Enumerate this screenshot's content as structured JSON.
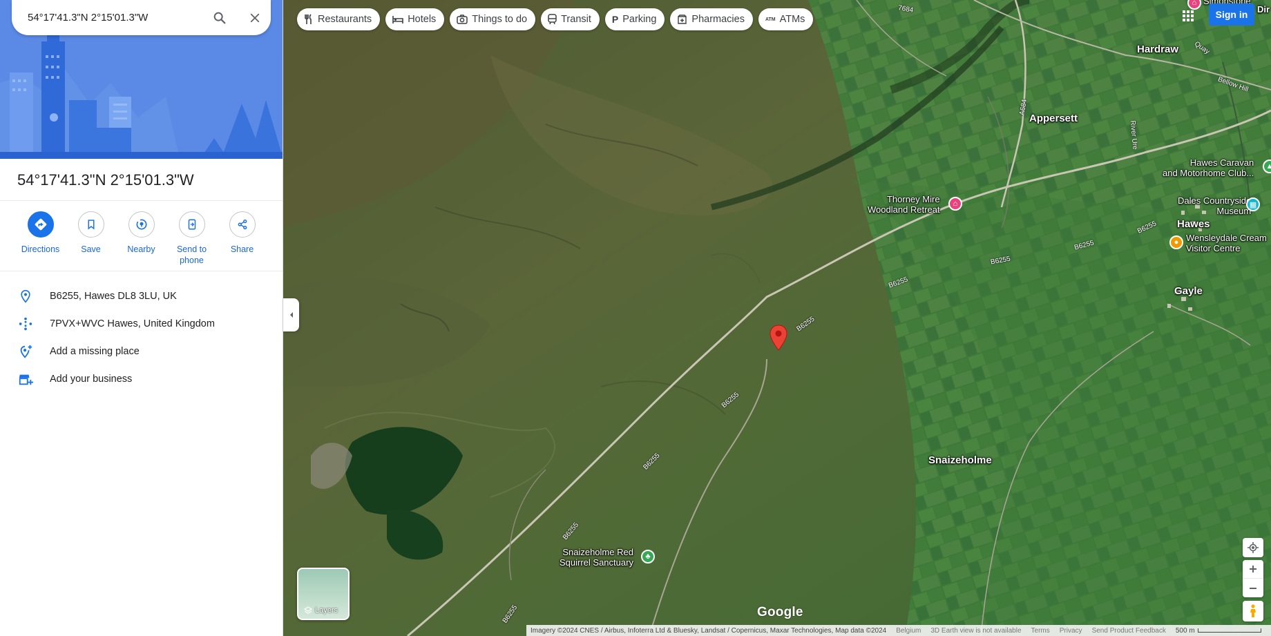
{
  "search": {
    "value": "54°17'41.3\"N 2°15'01.3\"W",
    "search_icon": "search-icon",
    "clear_icon": "close-icon"
  },
  "place": {
    "title": "54°17'41.3\"N 2°15'01.3\"W"
  },
  "actions": [
    {
      "label": "Directions",
      "icon": "directions-icon"
    },
    {
      "label": "Save",
      "icon": "bookmark-icon"
    },
    {
      "label": "Nearby",
      "icon": "nearby-icon"
    },
    {
      "label": "Send to phone",
      "icon": "phone-icon"
    },
    {
      "label": "Share",
      "icon": "share-icon"
    }
  ],
  "info": [
    {
      "text": "B6255, Hawes DL8 3LU, UK",
      "icon": "location-pin-icon"
    },
    {
      "text": "7PVX+WVC Hawes, United Kingdom",
      "icon": "plus-code-icon"
    },
    {
      "text": "Add a missing place",
      "icon": "add-location-icon"
    },
    {
      "text": "Add your business",
      "icon": "add-business-icon"
    }
  ],
  "chips": [
    {
      "label": "Restaurants",
      "icon": "restaurant-icon"
    },
    {
      "label": "Hotels",
      "icon": "hotel-icon"
    },
    {
      "label": "Things to do",
      "icon": "camera-icon"
    },
    {
      "label": "Transit",
      "icon": "transit-icon"
    },
    {
      "label": "Parking",
      "icon": "parking-icon"
    },
    {
      "label": "Pharmacies",
      "icon": "pharmacy-icon"
    },
    {
      "label": "ATMs",
      "icon": "atm-icon"
    }
  ],
  "header": {
    "signin": "Sign in"
  },
  "map_labels": {
    "hardraw": "Hardraw",
    "appersett": "Appersett",
    "thorney": "Thorney Mire\nWoodland Retreat",
    "hawes_caravan": "Hawes Caravan\nand Motorhome Club...",
    "dales": "Dales Countryside\nMuseum",
    "hawes": "Hawes",
    "wensleydale": "Wensleydale Cream\nVisitor Centre",
    "gayle": "Gayle",
    "snaizeholme": "Snaizeholme",
    "squirrel": "Snaizeholme Red\nSquirrel Sanctuary",
    "simonstone": "Simonstone",
    "dir": "Dir",
    "r7684": "7684",
    "r_a684": "A684",
    "river_ure": "River Ure",
    "quay": "Quay",
    "bellow_hill": "Bellow Hill",
    "b6255": "B6255"
  },
  "layers": {
    "label": "Layers"
  },
  "brand": {
    "logo": "Google"
  },
  "footer": {
    "imagery": "Imagery ©2024 CNES / Airbus, Infoterra Ltd & Bluesky, Landsat / Copernicus, Maxar Technologies, Map data ©2024",
    "country": "Belgium",
    "earth": "3D Earth view is not available",
    "terms": "Terms",
    "privacy": "Privacy",
    "feedback": "Send Product Feedback",
    "scale": "500 m"
  },
  "colors": {
    "accent": "#1a73e8",
    "pin": "#ea4335",
    "hotel_poi": "#e8437e",
    "museum_poi": "#12b5cb",
    "food_poi": "#f29900",
    "park_poi": "#34a853"
  }
}
